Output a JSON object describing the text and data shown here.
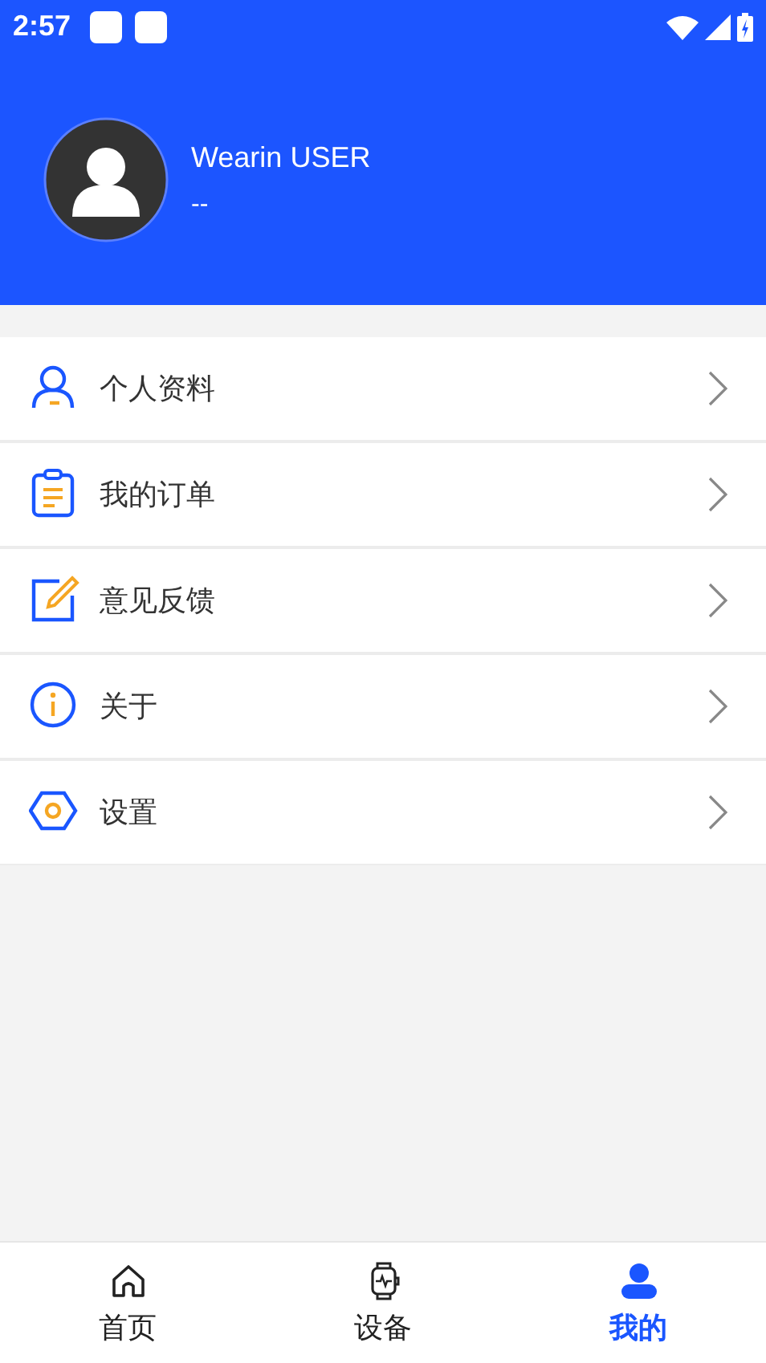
{
  "status_bar": {
    "time": "2:57"
  },
  "profile": {
    "name": "Wearin USER",
    "subtitle": "--"
  },
  "menu": [
    {
      "kind": "profile",
      "label": "个人资料"
    },
    {
      "kind": "orders",
      "label": "我的订单"
    },
    {
      "kind": "feedback",
      "label": "意见反馈"
    },
    {
      "kind": "about",
      "label": "关于"
    },
    {
      "kind": "settings",
      "label": "设置"
    }
  ],
  "tabs": [
    {
      "kind": "home",
      "label": "首页",
      "selected": false
    },
    {
      "kind": "device",
      "label": "设备",
      "selected": false
    },
    {
      "kind": "me",
      "label": "我的",
      "selected": true
    }
  ]
}
